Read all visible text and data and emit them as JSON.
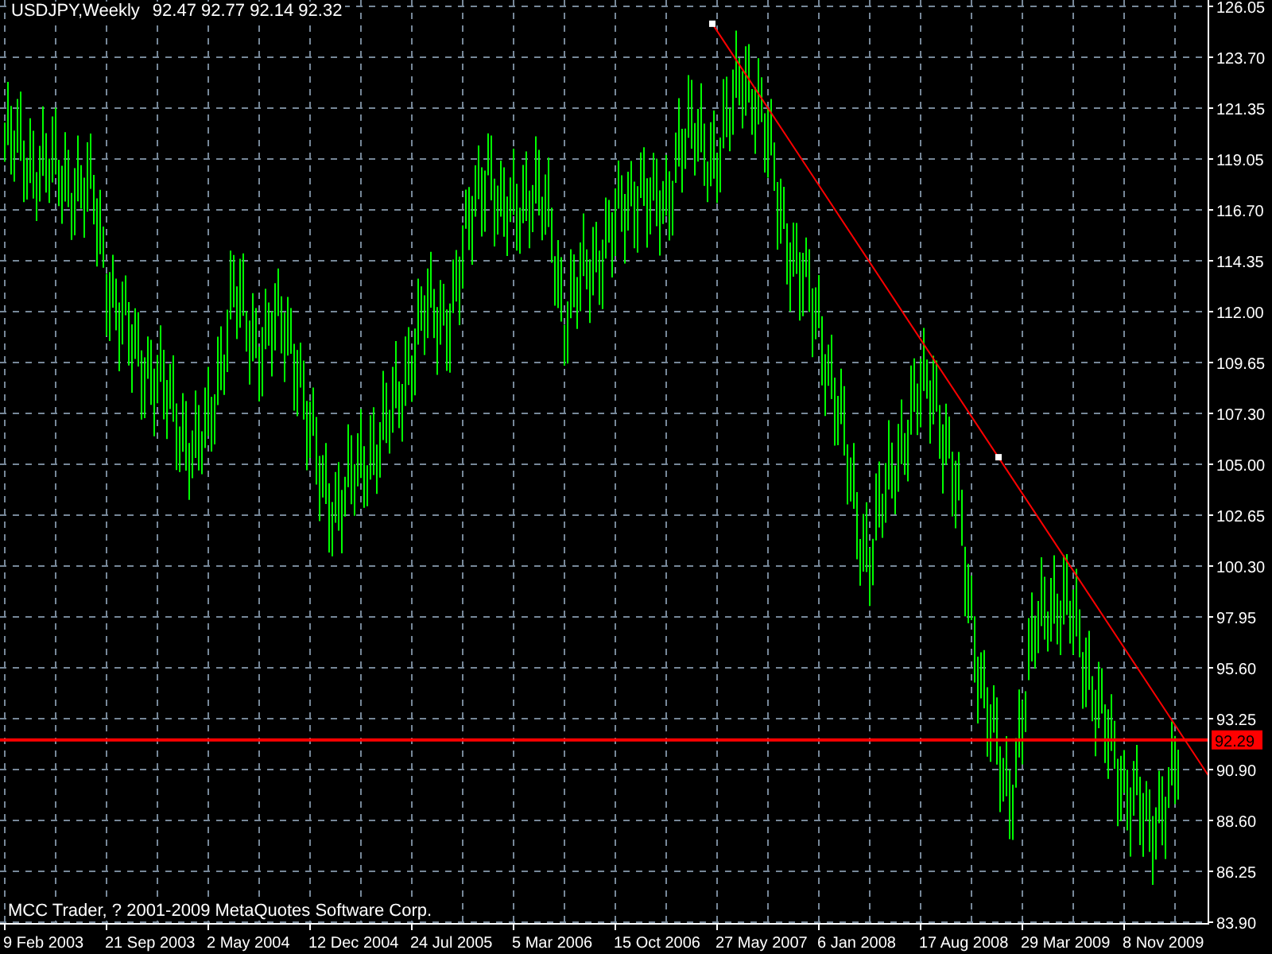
{
  "header": {
    "symbol": "USDJPY,Weekly",
    "quote": "92.47 92.77 92.14 92.32"
  },
  "price_axis": [
    "126.05",
    "123.70",
    "121.35",
    "119.05",
    "116.70",
    "114.35",
    "112.00",
    "109.65",
    "107.30",
    "105.00",
    "102.65",
    "100.30",
    "97.95",
    "95.60",
    "93.25",
    "90.90",
    "88.60",
    "86.25",
    "83.90"
  ],
  "time_axis": [
    "9 Feb 2003",
    "21 Sep 2003",
    "2 May 2004",
    "12 Dec 2004",
    "24 Jul 2005",
    "5 Mar 2006",
    "15 Oct 2006",
    "27 May 2007",
    "6 Jan 2008",
    "17 Aug 2008",
    "29 Mar 2009",
    "8 Nov 2009"
  ],
  "objects": [
    {
      "kind": "trendline"
    },
    {
      "kind": "hline",
      "label": "92.29"
    }
  ],
  "copyright": "MCC Trader, ? 2001-2009 MetaQuotes Software Corp."
}
